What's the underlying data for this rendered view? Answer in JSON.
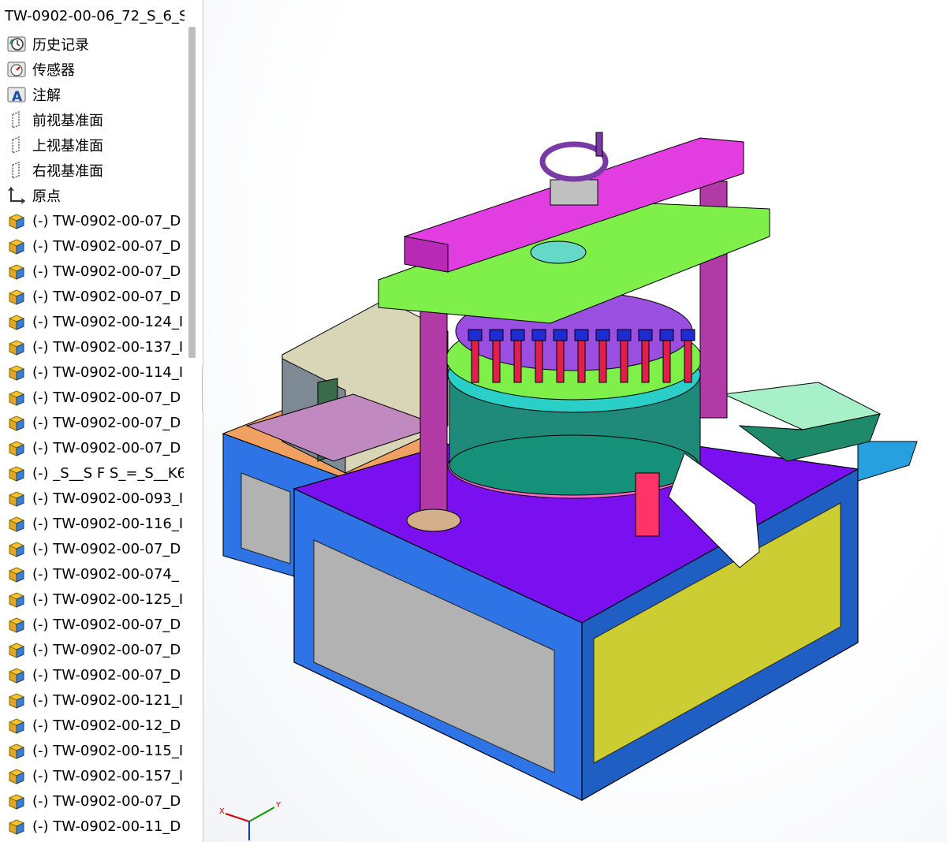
{
  "feature_tree": {
    "title": "TW-0902-00-06_72_S_6_S",
    "items": [
      {
        "label": "历史记录",
        "icon": "history-icon"
      },
      {
        "label": "传感器",
        "icon": "sensor-icon"
      },
      {
        "label": "注解",
        "icon": "annotation-icon"
      },
      {
        "label": "前视基准面",
        "icon": "plane-icon"
      },
      {
        "label": "上视基准面",
        "icon": "plane-icon"
      },
      {
        "label": "右视基准面",
        "icon": "plane-icon"
      },
      {
        "label": "原点",
        "icon": "origin-icon"
      },
      {
        "label": "(-) TW-0902-00-07_D",
        "icon": "part-icon"
      },
      {
        "label": "(-) TW-0902-00-07_D",
        "icon": "part-icon"
      },
      {
        "label": "(-) TW-0902-00-07_D",
        "icon": "part-icon"
      },
      {
        "label": "(-) TW-0902-00-07_D",
        "icon": "part-icon"
      },
      {
        "label": "(-) TW-0902-00-124_I",
        "icon": "part-icon"
      },
      {
        "label": "(-) TW-0902-00-137_I",
        "icon": "part-icon"
      },
      {
        "label": "(-) TW-0902-00-114_I",
        "icon": "part-icon"
      },
      {
        "label": "(-) TW-0902-00-07_D",
        "icon": "part-icon"
      },
      {
        "label": "(-) TW-0902-00-07_D",
        "icon": "part-icon"
      },
      {
        "label": "(-) TW-0902-00-07_D",
        "icon": "part-icon"
      },
      {
        "label": "(-) _S__S F S_=_S__K6",
        "icon": "part-icon"
      },
      {
        "label": "(-) TW-0902-00-093_I",
        "icon": "part-icon"
      },
      {
        "label": "(-) TW-0902-00-116_I",
        "icon": "part-icon"
      },
      {
        "label": "(-) TW-0902-00-07_D",
        "icon": "part-icon"
      },
      {
        "label": "(-) TW-0902-00-074_",
        "icon": "part-icon"
      },
      {
        "label": "(-) TW-0902-00-125_I",
        "icon": "part-icon"
      },
      {
        "label": "(-) TW-0902-00-07_D",
        "icon": "part-icon"
      },
      {
        "label": "(-) TW-0902-00-07_D",
        "icon": "part-icon"
      },
      {
        "label": "(-) TW-0902-00-07_D",
        "icon": "part-icon"
      },
      {
        "label": "(-) TW-0902-00-121_I",
        "icon": "part-icon"
      },
      {
        "label": "(-) TW-0902-00-12_D",
        "icon": "part-icon"
      },
      {
        "label": "(-) TW-0902-00-115_I",
        "icon": "part-icon"
      },
      {
        "label": "(-) TW-0902-00-157_I",
        "icon": "part-icon"
      },
      {
        "label": "(-) TW-0902-00-07_D",
        "icon": "part-icon"
      },
      {
        "label": "(-) TW-0902-00-11_D",
        "icon": "part-icon"
      }
    ]
  },
  "triad": {
    "x": "X",
    "y": "Y"
  },
  "colors": {
    "base_blue": "#2f74e6",
    "top_violet": "#7a10f0",
    "plate_pink": "#e23de0",
    "plate_green": "#7ff04a",
    "column_purple": "#b23aa6",
    "panel_yellow": "#cccc33",
    "panel_gray": "#b2b2b2",
    "chute_mint": "#a8f0c8",
    "drum_teal": "#1f8a7a"
  }
}
